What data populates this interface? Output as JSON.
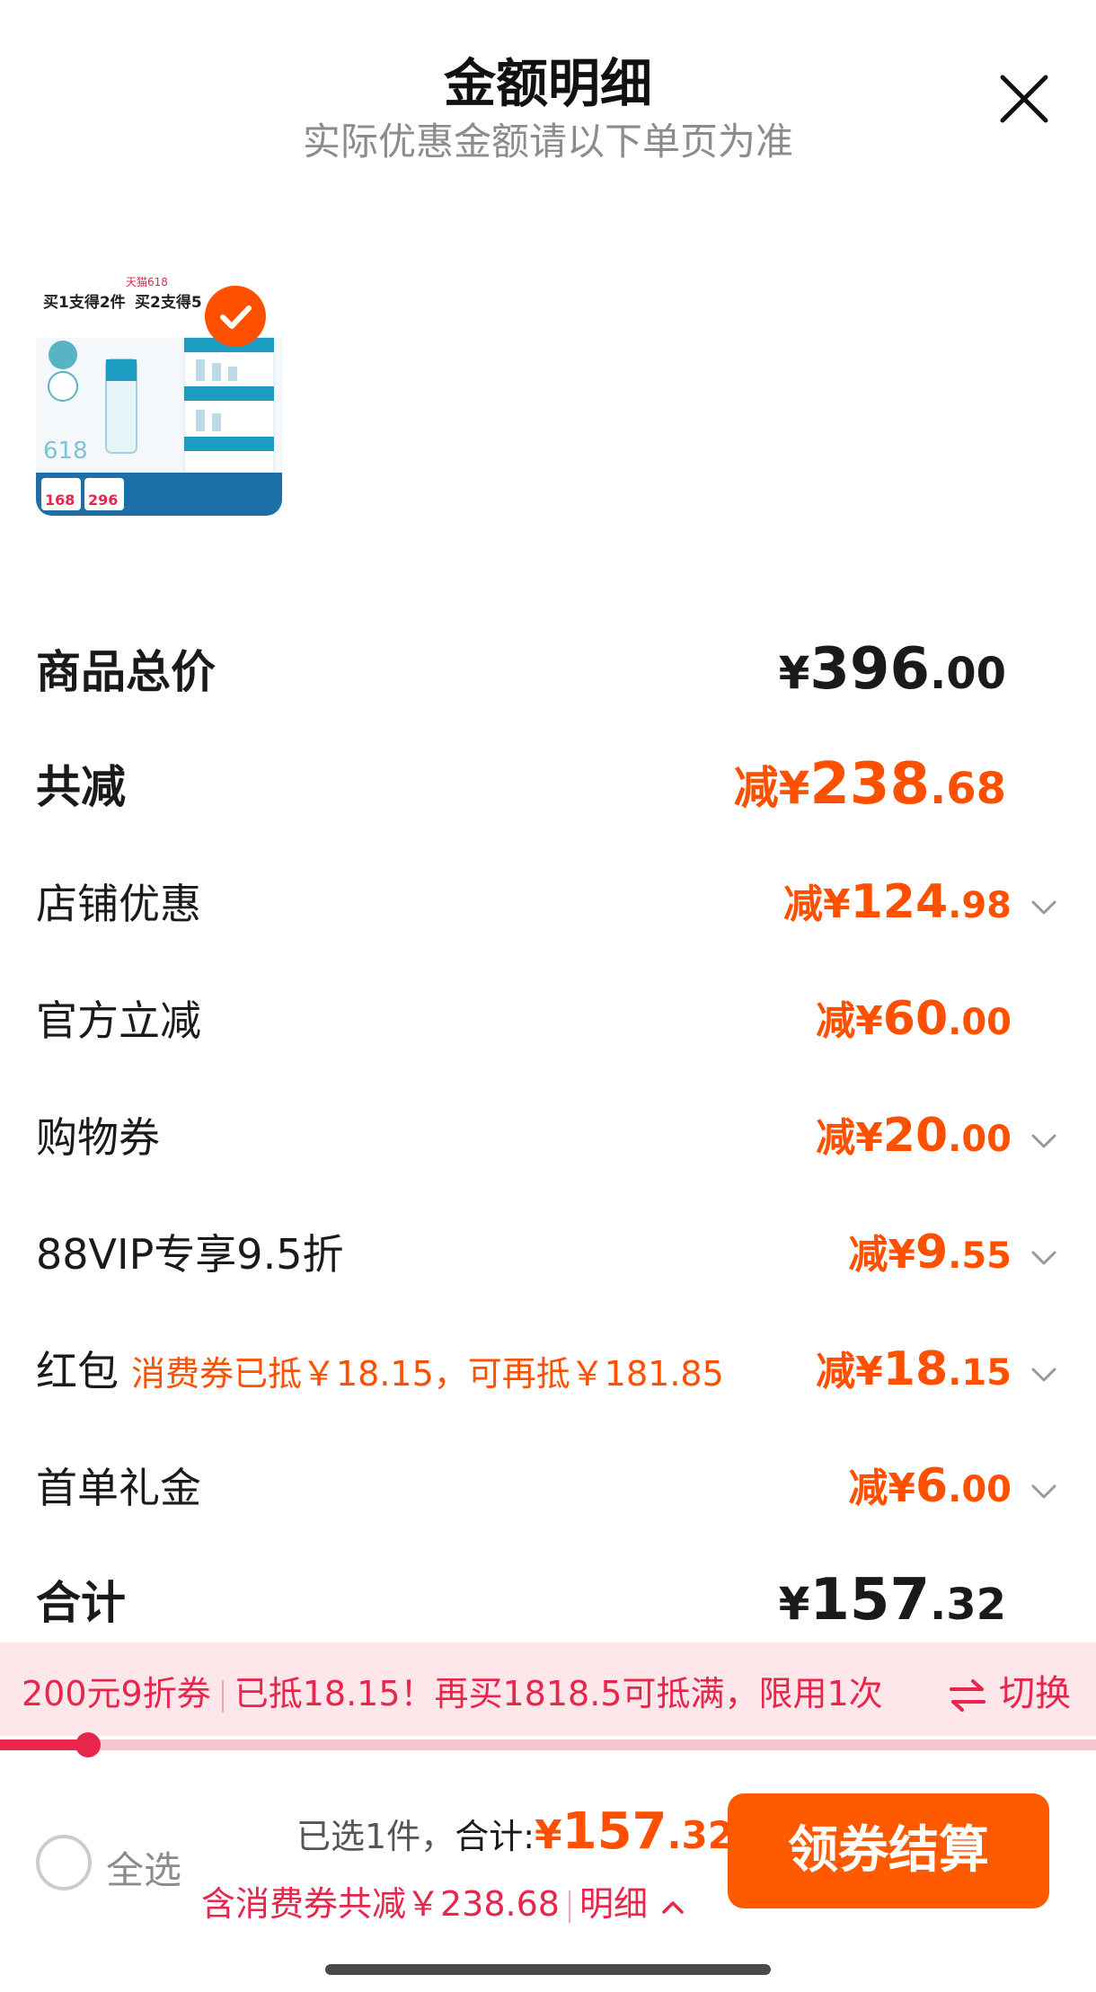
{
  "header": {
    "title": "金额明细",
    "subtitle": "实际优惠金额请以下单页为准"
  },
  "product": {
    "selected": true,
    "thumb_texts": [
      "买1支得2件",
      "买2支得5",
      "天猫618",
      "168",
      "296"
    ]
  },
  "rows": [
    {
      "label": "商品总价",
      "prefix": "",
      "yen": "¥",
      "integer": "396",
      "decimal": ".00",
      "expandable": false
    },
    {
      "label": "共减",
      "prefix": "减",
      "yen": "¥",
      "integer": "238",
      "decimal": ".68",
      "expandable": false
    },
    {
      "label": "店铺优惠",
      "prefix": "减",
      "yen": "¥",
      "integer": "124",
      "decimal": ".98",
      "expandable": true
    },
    {
      "label": "官方立减",
      "prefix": "减",
      "yen": "¥",
      "integer": "60",
      "decimal": ".00",
      "expandable": false
    },
    {
      "label": "购物券",
      "prefix": "减",
      "yen": "¥",
      "integer": "20",
      "decimal": ".00",
      "expandable": true
    },
    {
      "label": "88VIP专享9.5折",
      "prefix": "减",
      "yen": "¥",
      "integer": "9",
      "decimal": ".55",
      "expandable": true
    },
    {
      "label": "红包",
      "note": "消费券已抵￥18.15，可再抵￥181.85",
      "prefix": "减",
      "yen": "¥",
      "integer": "18",
      "decimal": ".15",
      "expandable": true
    },
    {
      "label": "首单礼金",
      "prefix": "减",
      "yen": "¥",
      "integer": "6",
      "decimal": ".00",
      "expandable": true
    },
    {
      "label": "合计",
      "prefix": "",
      "yen": "¥",
      "integer": "157",
      "decimal": ".32",
      "expandable": false
    }
  ],
  "promo": {
    "coupon": "200元9折券",
    "message": "已抵18.15！再买1818.5可抵满，限用1次",
    "switch_label": "切换",
    "progress": 0.08
  },
  "footer": {
    "select_all": "全选",
    "selected_count": "已选1件，",
    "total_label": "合计:",
    "total_yen": "¥",
    "total_integer": "157",
    "total_decimal": ".32",
    "discount_text": "含消费券共减￥238.68",
    "detail_label": "明细",
    "checkout_label": "领券结算"
  },
  "colors": {
    "accent_orange": "#ff5000",
    "accent_red": "#e8254a",
    "promo_bg": "#fde7ea"
  }
}
